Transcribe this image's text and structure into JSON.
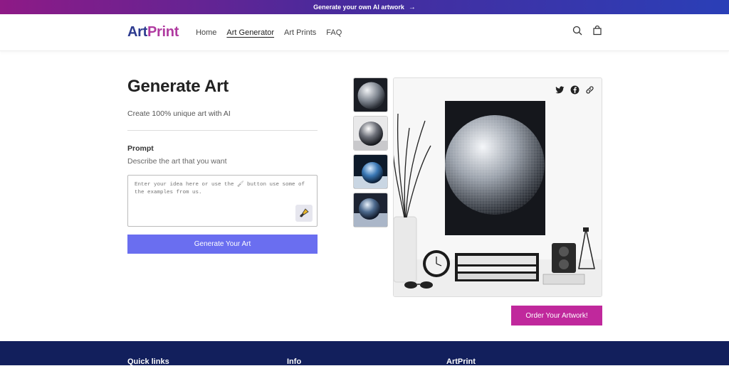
{
  "announcement": {
    "text": "Generate your own AI artwork",
    "arrow": "→"
  },
  "header": {
    "logo_part1": "Art",
    "logo_part2": "Print",
    "nav": [
      {
        "label": "Home",
        "active": false
      },
      {
        "label": "Art Generator",
        "active": true
      },
      {
        "label": "Art Prints",
        "active": false
      },
      {
        "label": "FAQ",
        "active": false
      }
    ],
    "icons": [
      "search-icon",
      "cart-icon"
    ]
  },
  "left": {
    "title": "Generate Art",
    "subtitle": "Create 100% unique art with AI",
    "prompt_label": "Prompt",
    "prompt_desc": "Describe the art that you want",
    "textarea_placeholder": "Enter your idea here or use the 🖌 button use some of the examples from us.",
    "generate_button": "Generate Your Art"
  },
  "preview": {
    "thumbnails": [
      "disco-ball-1",
      "disco-ball-2",
      "blue-sphere",
      "reflective-sphere"
    ],
    "share_icons": [
      "twitter-icon",
      "facebook-icon",
      "link-icon"
    ],
    "order_button": "Order Your Artwork!"
  },
  "footer": {
    "col1": "Quick links",
    "col2": "Info",
    "col3": "ArtPrint"
  },
  "colors": {
    "accent": "#6a6ef0",
    "order": "#c0289c",
    "footer": "#121f5c",
    "logo1": "#2d3b8f",
    "logo2": "#b03aa0"
  }
}
